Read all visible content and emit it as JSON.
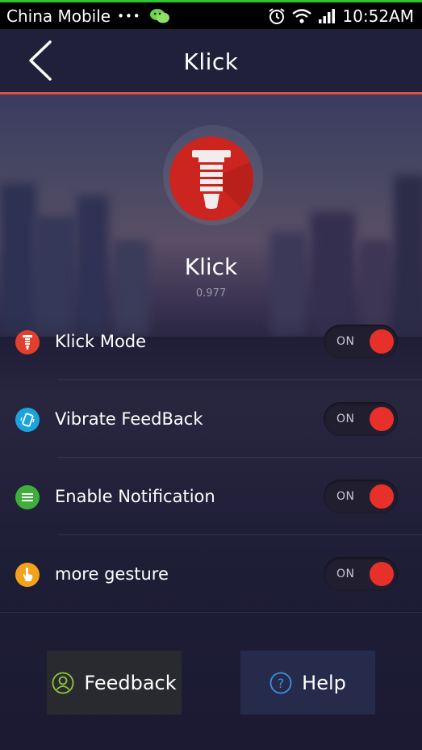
{
  "status_bar": {
    "carrier": "China Mobile",
    "dots": "•••",
    "time": "10:52AM",
    "icons": [
      "wechat-icon",
      "alarm-icon",
      "wifi-icon",
      "signal-icon"
    ]
  },
  "header": {
    "title": "Klick",
    "back_icon": "chevron-left-icon"
  },
  "app": {
    "name": "Klick",
    "version": "0.977",
    "logo_icon": "headphone-jack-icon"
  },
  "settings": [
    {
      "label": "Klick Mode",
      "toggle": "ON",
      "icon": "jack-icon",
      "icon_color": "#e0402d"
    },
    {
      "label": "Vibrate FeedBack",
      "toggle": "ON",
      "icon": "phone-vibrate-icon",
      "icon_color": "#1ca3dc"
    },
    {
      "label": "Enable Notification",
      "toggle": "ON",
      "icon": "list-icon",
      "icon_color": "#3fae3a"
    },
    {
      "label": "more gesture",
      "toggle": "ON",
      "icon": "hand-tap-icon",
      "icon_color": "#f2a21e"
    }
  ],
  "buttons": {
    "feedback": {
      "label": "Feedback",
      "icon": "user-icon"
    },
    "help": {
      "label": "Help",
      "icon": "question-icon"
    }
  },
  "colors": {
    "accent": "#e0513a",
    "toggle_knob": "#e8302a",
    "logo": "#cc241f"
  }
}
